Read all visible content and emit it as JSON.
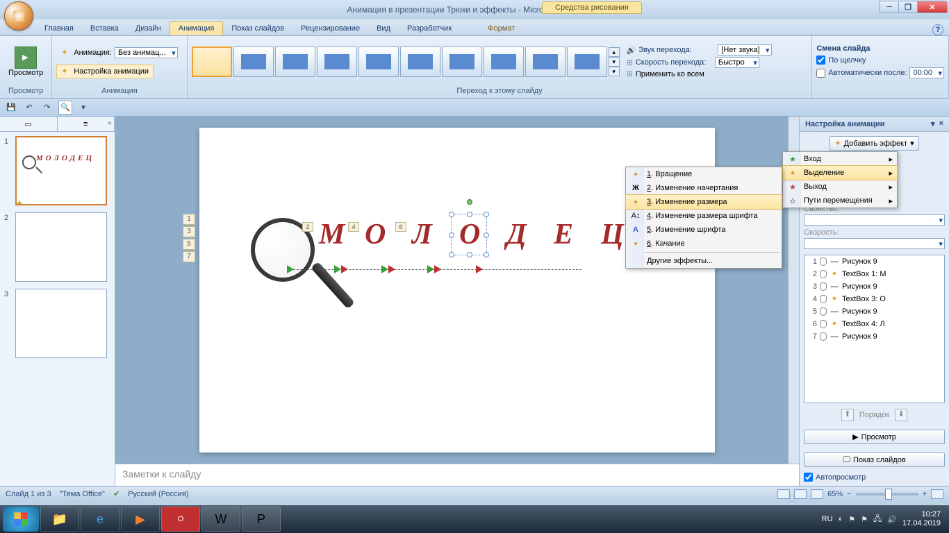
{
  "title": "Анимация в презентации Трюки и эффекты - Microsoft PowerPoint",
  "context_tab": "Средства рисования",
  "tabs": [
    "Главная",
    "Вставка",
    "Дизайн",
    "Анимация",
    "Показ слайдов",
    "Рецензирование",
    "Вид",
    "Разработчик",
    "Формат"
  ],
  "active_tab_index": 3,
  "ribbon": {
    "preview_label": "Просмотр",
    "preview_group": "Просмотр",
    "anim_label": "Анимация:",
    "anim_value": "Без анимац...",
    "custom_anim": "Настройка анимации",
    "anim_group": "Анимация",
    "transition_group": "Переход к этому слайду",
    "sound_label": "Звук перехода:",
    "sound_value": "[Нет звука]",
    "speed_label": "Скорость перехода:",
    "speed_value": "Быстро",
    "apply_all": "Применить ко всем",
    "advance_group": "Смена слайда",
    "on_click": "По щелчку",
    "auto_after": "Автоматически после:",
    "auto_time": "00:00"
  },
  "slide_numbers": [
    "1",
    "2",
    "3"
  ],
  "slide_tags": [
    "1",
    "3",
    "5",
    "7"
  ],
  "slide_num_tags": [
    "2",
    "4",
    "6"
  ],
  "slide_letters": [
    "М",
    "О",
    "Л",
    "О",
    "Д",
    "Е",
    "Ц"
  ],
  "notes_placeholder": "Заметки к слайду",
  "effect_menu": {
    "items": [
      "Вход",
      "Выделение",
      "Выход",
      "Пути перемещения"
    ],
    "highlighted": 1
  },
  "emphasis_menu": {
    "items": [
      {
        "n": "1",
        "label": "Вращение"
      },
      {
        "n": "2",
        "label": "Изменение начертания"
      },
      {
        "n": "3",
        "label": "Изменение размера"
      },
      {
        "n": "4",
        "label": "Изменение размера шрифта"
      },
      {
        "n": "5",
        "label": "Изменение шрифта"
      },
      {
        "n": "6",
        "label": "Качание"
      }
    ],
    "other": "Другие эффекты...",
    "highlighted": 2
  },
  "anim_pane": {
    "title": "Настройка анимации",
    "add_effect": "Добавить эффект",
    "prop_label": "Свойство:",
    "speed_label": "Скорость:",
    "items": [
      {
        "n": "1",
        "type": "path",
        "label": "Рисунок 9"
      },
      {
        "n": "2",
        "type": "emph",
        "label": "TextBox 1: М"
      },
      {
        "n": "3",
        "type": "path",
        "label": "Рисунок 9"
      },
      {
        "n": "4",
        "type": "emph",
        "label": "TextBox 3: О"
      },
      {
        "n": "5",
        "type": "path",
        "label": "Рисунок 9"
      },
      {
        "n": "6",
        "type": "emph",
        "label": "TextBox 4: Л"
      },
      {
        "n": "7",
        "type": "path",
        "label": "Рисунок 9"
      }
    ],
    "order": "Порядок",
    "preview": "Просмотр",
    "slideshow": "Показ слайдов",
    "autopreview": "Автопросмотр"
  },
  "status": {
    "slide": "Слайд 1 из 3",
    "theme": "\"Тема Office\"",
    "lang": "Русский (Россия)",
    "zoom": "65%"
  },
  "tray": {
    "lang": "RU",
    "time": "10:27",
    "date": "17.04.2019"
  }
}
